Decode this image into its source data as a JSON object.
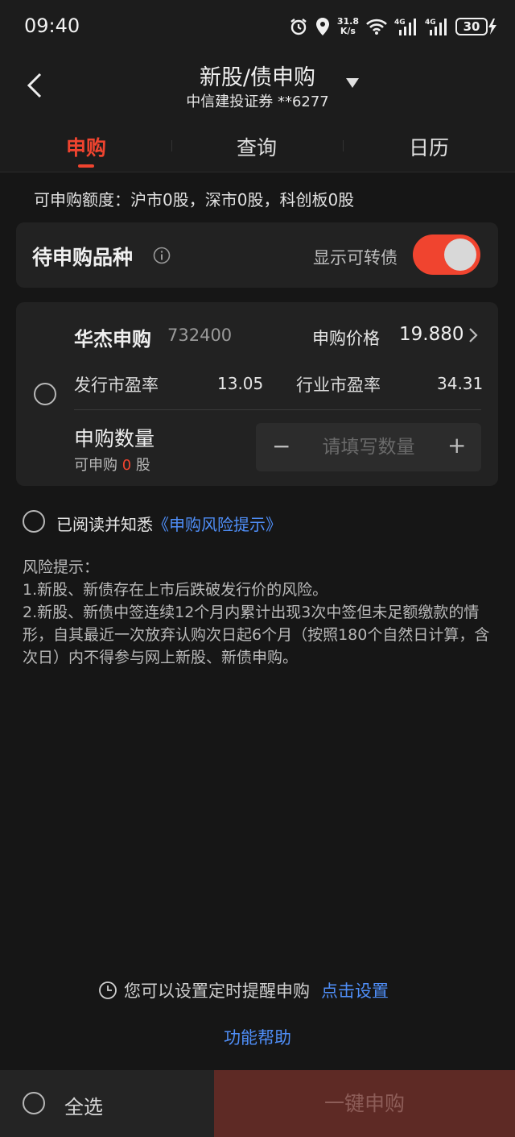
{
  "status": {
    "time": "09:40",
    "speed_value": "31.8",
    "speed_unit": "K/s",
    "battery": "30"
  },
  "nav": {
    "title": "新股/债申购",
    "broker": "中信建投证券",
    "account": "**6277"
  },
  "tabs": [
    {
      "label": "申购",
      "active": true
    },
    {
      "label": "查询"
    },
    {
      "label": "日历"
    }
  ],
  "quota_text": "可申购额度：沪市0股，深市0股，科创板0股",
  "pending": {
    "title": "待申购品种",
    "toggle_label": "显示可转债",
    "toggle_on": true
  },
  "stock": {
    "name": "华杰申购",
    "code": "732400",
    "price_label": "申购价格",
    "price": "19.880",
    "issue_pe_label": "发行市盈率",
    "issue_pe": "13.05",
    "industry_pe_label": "行业市盈率",
    "industry_pe": "34.31",
    "qty_label": "申购数量",
    "avail_prefix": "可申购",
    "avail_value": "0",
    "avail_unit": "股",
    "qty_placeholder": "请填写数量",
    "minus": "−",
    "plus": "+"
  },
  "agree": {
    "text": "已阅读并知悉",
    "link": "《申购风险提示》"
  },
  "risk": {
    "title": "风险提示：",
    "line1": "1.新股、新债存在上市后跌破发行价的风险。",
    "line2": "2.新股、新债中签连续12个月内累计出现3次中签但未足额缴款的情形，自其最近一次放弃认购次日起6个月（按照180个自然日计算，含次日）内不得参与网上新股、新债申购。"
  },
  "reminder": {
    "text": "您可以设置定时提醒申购",
    "link": "点击设置"
  },
  "help_link": "功能帮助",
  "bottom": {
    "select_all": "全选",
    "submit": "一键申购"
  },
  "colors": {
    "accent": "#f0442f",
    "link": "#4f8ef7",
    "background": "#161616",
    "card": "#222222"
  }
}
